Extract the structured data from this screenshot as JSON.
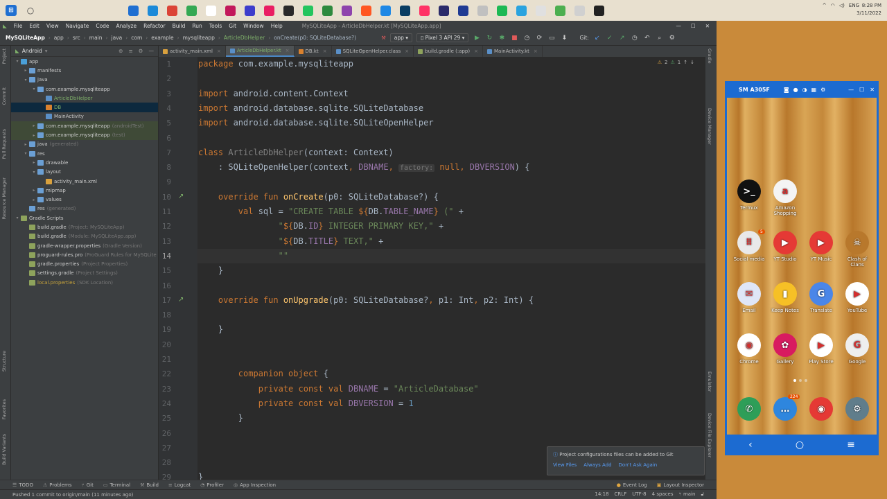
{
  "taskbar": {
    "tray_lang": "ENG",
    "clock_time": "8:28 PM",
    "clock_date": "3/11/2022"
  },
  "menu": {
    "items": [
      "File",
      "Edit",
      "View",
      "Navigate",
      "Code",
      "Analyze",
      "Refactor",
      "Build",
      "Run",
      "Tools",
      "Git",
      "Window",
      "Help"
    ],
    "window_title": "MySQLiteApp - ArticleDbHelper.kt [MySQLiteApp.app]"
  },
  "nav": {
    "crumbs": [
      "MySQLiteApp",
      "app",
      "src",
      "main",
      "java",
      "com",
      "example",
      "mysqliteapp",
      "ArticleDbHelper",
      "onCreate(p0: SQLiteDatabase?)"
    ],
    "config": "app",
    "device": "Pixel 3 API 29",
    "git_label": "Git:"
  },
  "project": {
    "view": "Android",
    "tree": [
      {
        "label": "app",
        "level": 0,
        "arrow": "▾",
        "color": "#4a9fd8",
        "hl": ""
      },
      {
        "label": "manifests",
        "level": 1,
        "arrow": "▸",
        "color": "#6b9fd4",
        "hl": ""
      },
      {
        "label": "java",
        "level": 1,
        "arrow": "▾",
        "color": "#6b9fd4",
        "hl": ""
      },
      {
        "label": "com.example.mysqliteapp",
        "level": 2,
        "arrow": "▾",
        "color": "#6b9fd4",
        "hl": ""
      },
      {
        "label": "ArticleDbHelper",
        "level": 3,
        "arrow": "",
        "color": "#5a8fc7",
        "hl": "",
        "green": true
      },
      {
        "label": "DB",
        "level": 3,
        "arrow": "",
        "color": "#d9812e",
        "hl": "sel",
        "green": true
      },
      {
        "label": "MainActivity",
        "level": 3,
        "arrow": "",
        "color": "#5a8fc7",
        "hl": ""
      },
      {
        "label": "com.example.mysqliteapp",
        "dim": "(androidTest)",
        "level": 2,
        "arrow": "▸",
        "color": "#6b9fd4",
        "hl": "hl"
      },
      {
        "label": "com.example.mysqliteapp",
        "dim": "(test)",
        "level": 2,
        "arrow": "▸",
        "color": "#6b9fd4",
        "hl": "hl"
      },
      {
        "label": "java",
        "dim": "(generated)",
        "level": 1,
        "arrow": "▸",
        "color": "#6b9fd4",
        "hl": ""
      },
      {
        "label": "res",
        "level": 1,
        "arrow": "▾",
        "color": "#6b9fd4",
        "hl": ""
      },
      {
        "label": "drawable",
        "level": 2,
        "arrow": "▸",
        "color": "#6b9fd4",
        "hl": ""
      },
      {
        "label": "layout",
        "level": 2,
        "arrow": "▾",
        "color": "#6b9fd4",
        "hl": ""
      },
      {
        "label": "activity_main.xml",
        "level": 3,
        "arrow": "",
        "color": "#d9a13e",
        "hl": ""
      },
      {
        "label": "mipmap",
        "level": 2,
        "arrow": "▸",
        "color": "#6b9fd4",
        "hl": ""
      },
      {
        "label": "values",
        "level": 2,
        "arrow": "▸",
        "color": "#6b9fd4",
        "hl": ""
      },
      {
        "label": "res",
        "dim": "(generated)",
        "level": 1,
        "arrow": "",
        "color": "#6b9fd4",
        "hl": ""
      },
      {
        "label": "Gradle Scripts",
        "level": 0,
        "arrow": "▾",
        "color": "#8ea35c",
        "hl": ""
      },
      {
        "label": "build.gradle",
        "dim": "(Project: MySQLiteApp)",
        "level": 1,
        "arrow": "",
        "color": "#8ea35c",
        "hl": ""
      },
      {
        "label": "build.gradle",
        "dim": "(Module: MySQLiteApp.app)",
        "level": 1,
        "arrow": "",
        "color": "#8ea35c",
        "hl": ""
      },
      {
        "label": "gradle-wrapper.properties",
        "dim": "(Gradle Version)",
        "level": 1,
        "arrow": "",
        "color": "#8ea35c",
        "hl": ""
      },
      {
        "label": "proguard-rules.pro",
        "dim": "(ProGuard Rules for MySQLite",
        "level": 1,
        "arrow": "",
        "color": "#8ea35c",
        "hl": ""
      },
      {
        "label": "gradle.properties",
        "dim": "(Project Properties)",
        "level": 1,
        "arrow": "",
        "color": "#8ea35c",
        "hl": ""
      },
      {
        "label": "settings.gradle",
        "dim": "(Project Settings)",
        "level": 1,
        "arrow": "",
        "color": "#8ea35c",
        "hl": ""
      },
      {
        "label": "local.properties",
        "dim": "(SDK Location)",
        "level": 1,
        "arrow": "",
        "color": "#8ea35c",
        "hl": "",
        "orange": true
      }
    ]
  },
  "tabs": [
    {
      "label": "activity_main.xml",
      "color": "#d9a13e",
      "active": false
    },
    {
      "label": "ArticleDbHelper.kt",
      "color": "#5a8fc7",
      "active": true
    },
    {
      "label": "DB.kt",
      "color": "#d9812e",
      "active": false
    },
    {
      "label": "SQLiteOpenHelper.class",
      "color": "#5a8fc7",
      "active": false
    },
    {
      "label": "build.gradle (:app)",
      "color": "#8ea35c",
      "active": false
    },
    {
      "label": "MainActivity.kt",
      "color": "#5a8fc7",
      "active": false
    }
  ],
  "inspection": {
    "warnings": "2",
    "weak": "1"
  },
  "code": {
    "current_line": 14,
    "lines": [
      [
        [
          "kw",
          "package "
        ],
        [
          "cls",
          "com.example.mysqliteapp"
        ]
      ],
      [],
      [
        [
          "kw",
          "import "
        ],
        [
          "cls",
          "android.content.Context"
        ]
      ],
      [
        [
          "kw",
          "import "
        ],
        [
          "cls",
          "android.database.sqlite.SQLiteDatabase"
        ]
      ],
      [
        [
          "kw",
          "import "
        ],
        [
          "cls",
          "android.database.sqlite.SQLiteOpenHelper"
        ]
      ],
      [],
      [
        [
          "kw",
          "class "
        ],
        [
          "unused",
          "ArticleDbHelper"
        ],
        [
          "cls",
          "(context: Context)"
        ]
      ],
      [
        [
          "cls",
          "    : SQLiteOpenHelper(context"
        ],
        [
          "kw",
          ", "
        ],
        [
          "fld",
          "DBNAME"
        ],
        [
          "kw",
          ", "
        ],
        [
          "hint",
          "factory:"
        ],
        [
          "kw",
          " null"
        ],
        [
          "kw",
          ", "
        ],
        [
          "fld",
          "DBVERSION"
        ],
        [
          "cls",
          ") {"
        ]
      ],
      [],
      [
        [
          "kw",
          "    override fun "
        ],
        [
          "fn",
          "onCreate"
        ],
        [
          "cls",
          "(p0: SQLiteDatabase?) {"
        ]
      ],
      [
        [
          "kw",
          "        val "
        ],
        [
          "cls",
          "sql = "
        ],
        [
          "str",
          "\"CREATE TABLE "
        ],
        [
          "tmpl",
          "${"
        ],
        [
          "cls",
          "DB."
        ],
        [
          "fld",
          "TABLE_NAME"
        ],
        [
          "tmpl",
          "}"
        ],
        [
          "str",
          " (\""
        ],
        [
          "cls",
          " +"
        ]
      ],
      [
        [
          "str",
          "                \""
        ],
        [
          "tmpl",
          "${"
        ],
        [
          "cls",
          "DB."
        ],
        [
          "fld",
          "ID"
        ],
        [
          "tmpl",
          "}"
        ],
        [
          "str",
          " INTEGER PRIMARY KEY,\""
        ],
        [
          "cls",
          " +"
        ]
      ],
      [
        [
          "str",
          "                \""
        ],
        [
          "tmpl",
          "${"
        ],
        [
          "cls",
          "DB."
        ],
        [
          "fld",
          "TITLE"
        ],
        [
          "tmpl",
          "}"
        ],
        [
          "str",
          " TEXT,\""
        ],
        [
          "cls",
          " +"
        ]
      ],
      [
        [
          "str",
          "                \"\""
        ]
      ],
      [
        [
          "cls",
          "    }"
        ]
      ],
      [],
      [
        [
          "kw",
          "    override fun "
        ],
        [
          "fn",
          "onUpgrade"
        ],
        [
          "cls",
          "(p0: SQLiteDatabase?"
        ],
        [
          "kw",
          ", "
        ],
        [
          "cls",
          "p1: Int"
        ],
        [
          "kw",
          ", "
        ],
        [
          "cls",
          "p2: Int) {"
        ]
      ],
      [],
      [
        [
          "cls",
          "    }"
        ]
      ],
      [],
      [],
      [
        [
          "kw",
          "        companion object "
        ],
        [
          "cls",
          "{"
        ]
      ],
      [
        [
          "kw",
          "            private const val "
        ],
        [
          "fld",
          "DBNAME"
        ],
        [
          "cls",
          " = "
        ],
        [
          "str",
          "\"ArticleDatabase\""
        ]
      ],
      [
        [
          "kw",
          "            private const val "
        ],
        [
          "fld",
          "DBVERSION"
        ],
        [
          "cls",
          " = "
        ],
        [
          "num",
          "1"
        ]
      ],
      [
        [
          "cls",
          "        }"
        ]
      ],
      [],
      [],
      [],
      [
        [
          "cls",
          "}"
        ]
      ]
    ]
  },
  "bottom_tools": [
    "TODO",
    "Problems",
    "Git",
    "Terminal",
    "Build",
    "Logcat",
    "Profiler",
    "App Inspection"
  ],
  "bottom_right_tools": [
    "Event Log",
    "Layout Inspector"
  ],
  "status": {
    "message": "Pushed 1 commit to origin/main (11 minutes ago)",
    "position": "14:18",
    "line_sep": "CRLF",
    "encoding": "UTF-8",
    "indent": "4 spaces",
    "branch": "main"
  },
  "notification": {
    "text": "Project configurations files can be added to Git",
    "links": [
      "View Files",
      "Always Add",
      "Don't Ask Again"
    ]
  },
  "side_tabs_left": [
    "Project",
    "Commit",
    "Pull Requests",
    "Resource Manager",
    "Structure",
    "Favorites",
    "Build Variants"
  ],
  "side_tabs_right": [
    "Gradle",
    "Device Manager",
    "Emulator",
    "Device File Explorer"
  ],
  "phone": {
    "title": "SM A305F",
    "apps": [
      {
        "label": "Termux",
        "bg": "#111",
        "glyph": ">_",
        "row": 0,
        "col": 0
      },
      {
        "label": "Amazon Shopping",
        "bg": "#f4f4f4",
        "glyph": "a",
        "row": 0,
        "col": 1
      },
      {
        "label": "Social media",
        "bg": "#e9e9e9",
        "glyph": "⠿",
        "row": 1,
        "col": 0
      },
      {
        "label": "YT Studio",
        "bg": "#e53935",
        "glyph": "▶",
        "row": 1,
        "col": 1
      },
      {
        "label": "YT Music",
        "bg": "#e53935",
        "glyph": "▶",
        "row": 1,
        "col": 2
      },
      {
        "label": "Clash of Clans",
        "bg": "#b8782c",
        "glyph": "☠",
        "row": 1,
        "col": 3
      },
      {
        "label": "Email",
        "bg": "#dfe6f7",
        "glyph": "✉",
        "row": 2,
        "col": 0
      },
      {
        "label": "Keep Notes",
        "bg": "#f6c026",
        "glyph": "▮",
        "row": 2,
        "col": 1
      },
      {
        "label": "Translate",
        "bg": "#4a86e8",
        "glyph": "G",
        "row": 2,
        "col": 2
      },
      {
        "label": "YouTube",
        "bg": "#ffffff",
        "glyph": "▶",
        "row": 2,
        "col": 3
      },
      {
        "label": "Chrome",
        "bg": "#ffffff",
        "glyph": "◉",
        "row": 3,
        "col": 0
      },
      {
        "label": "Gallery",
        "bg": "#d81b60",
        "glyph": "✿",
        "row": 3,
        "col": 1
      },
      {
        "label": "Play Store",
        "bg": "#ffffff",
        "glyph": "▶",
        "row": 3,
        "col": 2
      },
      {
        "label": "Google",
        "bg": "#eeeeee",
        "glyph": "G",
        "row": 3,
        "col": 3
      },
      {
        "label": "",
        "bg": "#2e9e58",
        "glyph": "✆",
        "row": 4,
        "col": 0
      },
      {
        "label": "",
        "bg": "#2e86de",
        "glyph": "…",
        "row": 4,
        "col": 1
      },
      {
        "label": "",
        "bg": "#e53935",
        "glyph": "◉",
        "row": 4,
        "col": 2
      },
      {
        "label": "",
        "bg": "#607d8b",
        "glyph": "⚙",
        "row": 4,
        "col": 3
      }
    ],
    "badges": {
      "social": "5",
      "messages": "224"
    }
  }
}
